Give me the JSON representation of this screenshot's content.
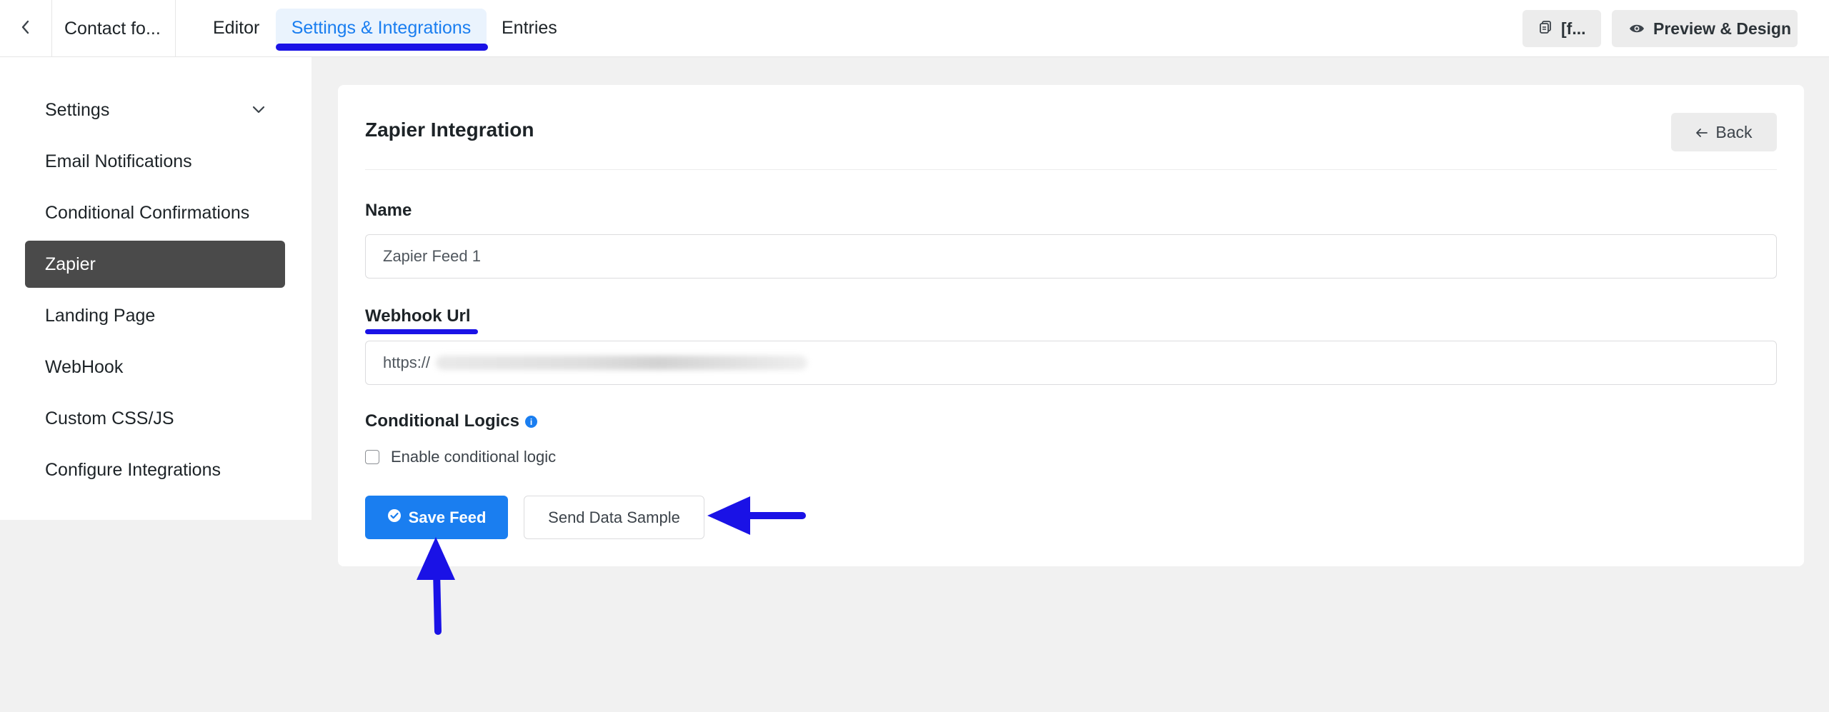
{
  "topbar": {
    "form_title": "Contact fo...",
    "tabs": [
      {
        "label": "Editor"
      },
      {
        "label": "Settings & Integrations"
      },
      {
        "label": "Entries"
      }
    ],
    "shortcode_label": "[f...",
    "preview_label": "Preview & Design"
  },
  "sidebar": {
    "items": [
      {
        "label": "Settings"
      },
      {
        "label": "Email Notifications"
      },
      {
        "label": "Conditional Confirmations"
      },
      {
        "label": "Zapier"
      },
      {
        "label": "Landing Page"
      },
      {
        "label": "WebHook"
      },
      {
        "label": "Custom CSS/JS"
      },
      {
        "label": "Configure Integrations"
      }
    ],
    "active_item": "Zapier"
  },
  "card": {
    "title": "Zapier Integration",
    "back_label": "Back",
    "name_label": "Name",
    "name_value": "Zapier Feed 1",
    "webhook_label": "Webhook Url",
    "webhook_value": "https://",
    "conditional_label": "Conditional Logics",
    "checkbox_label": "Enable conditional logic",
    "save_label": "Save Feed",
    "sample_label": "Send Data Sample"
  },
  "colors": {
    "accent": "#1a7ef0",
    "annotation": "#1a12e6",
    "active_sidebar_bg": "#4a4a4a"
  },
  "icons": {
    "back": "chevron-left-icon",
    "shortcode": "copy-icon",
    "preview": "eye-icon",
    "settings_toggle": "chevron-down-icon",
    "card_back": "arrow-left-icon",
    "info": "info-icon",
    "save": "check-circle-icon"
  }
}
